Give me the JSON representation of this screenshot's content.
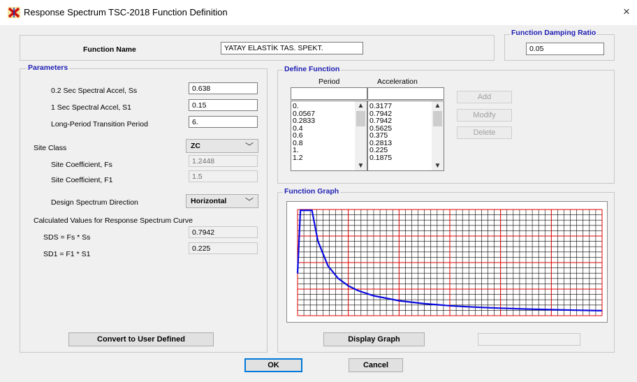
{
  "window": {
    "title": "Response Spectrum TSC-2018 Function Definition",
    "close_glyph": "×"
  },
  "function_name": {
    "label": "Function Name",
    "value": "YATAY ELASTİK TAS. SPEKT."
  },
  "damping": {
    "label": "Function Damping Ratio",
    "value": "0.05"
  },
  "parameters": {
    "label": "Parameters",
    "ss": {
      "label": "0.2 Sec Spectral Accel, Ss",
      "value": "0.638"
    },
    "s1": {
      "label": "1 Sec Spectral Accel, S1",
      "value": "0.15"
    },
    "tl": {
      "label": "Long-Period Transition Period",
      "value": "6."
    },
    "site_class": {
      "label": "Site Class",
      "value": "ZC"
    },
    "fs": {
      "label": "Site Coefficient, Fs",
      "value": "1.2448"
    },
    "f1": {
      "label": "Site Coefficient, F1",
      "value": "1.5"
    },
    "direction": {
      "label": "Design Spectrum Direction",
      "value": "Horizontal"
    },
    "calc_label": "Calculated Values for Response Spectrum Curve",
    "sds": {
      "label": "SDS =  Fs * Ss",
      "value": "0.7942"
    },
    "sd1": {
      "label": "SD1 =  F1 * S1",
      "value": "0.225"
    }
  },
  "define_function": {
    "label": "Define Function",
    "period_header": "Period",
    "accel_header": "Acceleration",
    "periods": [
      "0.",
      "0.0567",
      "0.2833",
      "0.4",
      "0.6",
      "0.8",
      "1.",
      "1.2"
    ],
    "accels": [
      "0.3177",
      "0.7942",
      "0.7942",
      "0.5625",
      "0.375",
      "0.2813",
      "0.225",
      "0.1875"
    ],
    "add_label": "Add",
    "modify_label": "Modify",
    "delete_label": "Delete"
  },
  "graph": {
    "label": "Function Graph",
    "display_label": "Display Graph",
    "colors": {
      "curve": "#0a0ae0",
      "major_grid": "#e00000",
      "minor_grid": "#000000"
    }
  },
  "chart_data": {
    "type": "line",
    "x": [
      0,
      0.0567,
      0.2833,
      0.4,
      0.6,
      0.8,
      1.0,
      1.2,
      1.5,
      2.0,
      2.5,
      3.0,
      3.5,
      4.0,
      4.5,
      5.0,
      5.5,
      6.0
    ],
    "y": [
      0.3177,
      0.7942,
      0.7942,
      0.5625,
      0.375,
      0.2813,
      0.225,
      0.1875,
      0.15,
      0.1125,
      0.09,
      0.075,
      0.0643,
      0.0563,
      0.05,
      0.045,
      0.0409,
      0.0375
    ],
    "xlim": [
      0,
      6
    ],
    "ylim": [
      0,
      0.8
    ],
    "grid": true
  },
  "buttons": {
    "convert_label": "Convert to User Defined",
    "ok_label": "OK",
    "cancel_label": "Cancel"
  }
}
